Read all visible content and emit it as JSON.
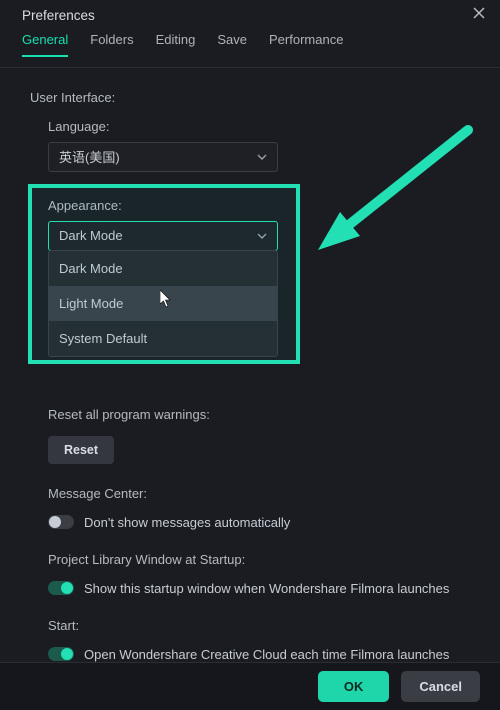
{
  "title": "Preferences",
  "tabs": [
    "General",
    "Folders",
    "Editing",
    "Save",
    "Performance"
  ],
  "active_tab": 0,
  "ui_label": "User Interface:",
  "language": {
    "label": "Language:",
    "value": "英语(美国)"
  },
  "appearance": {
    "label": "Appearance:",
    "value": "Dark Mode",
    "options": [
      "Dark Mode",
      "Light Mode",
      "System Default"
    ],
    "hover_index": 1
  },
  "reset": {
    "label": "Reset all program warnings:",
    "button": "Reset"
  },
  "message_center": {
    "label": "Message Center:",
    "toggle_label": "Don't show messages automatically",
    "on": false
  },
  "project_library": {
    "label": "Project Library Window at Startup:",
    "toggle_label": "Show this startup window when Wondershare Filmora launches",
    "on": true
  },
  "start": {
    "label": "Start:",
    "toggle_label": "Open Wondershare Creative Cloud each time Filmora launches",
    "on": true
  },
  "footer": {
    "ok": "OK",
    "cancel": "Cancel"
  }
}
